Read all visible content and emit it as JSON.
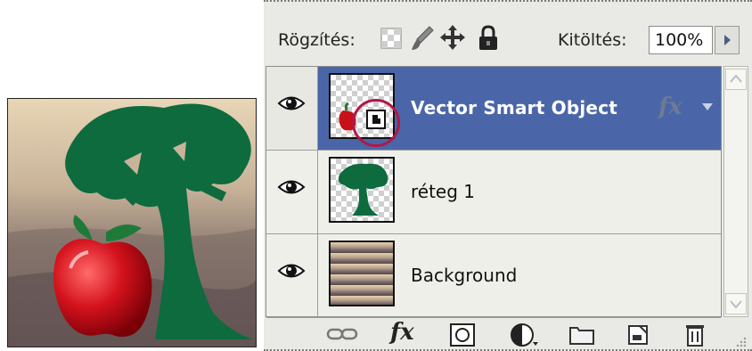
{
  "layers_panel": {
    "lock_label": "Rögzítés:",
    "fill_label": "Kitöltés:",
    "fill_value": "100%",
    "layers": [
      {
        "name": "Vector Smart Object",
        "selected": true,
        "visible": true,
        "has_fx": true,
        "fx_label": "fx",
        "smart_object": true
      },
      {
        "name": "réteg 1",
        "selected": false,
        "visible": true
      },
      {
        "name": "Background",
        "selected": false,
        "visible": true
      }
    ],
    "selection_color": "#4a66a8",
    "highlight_ring_color": "#b01846"
  },
  "bottom_toolbar": {
    "icons": [
      "link-layers-icon",
      "fx-icon",
      "layer-mask-icon",
      "adjustment-layer-icon",
      "new-group-icon",
      "new-layer-icon",
      "delete-layer-icon"
    ],
    "fx_label": "fx"
  }
}
